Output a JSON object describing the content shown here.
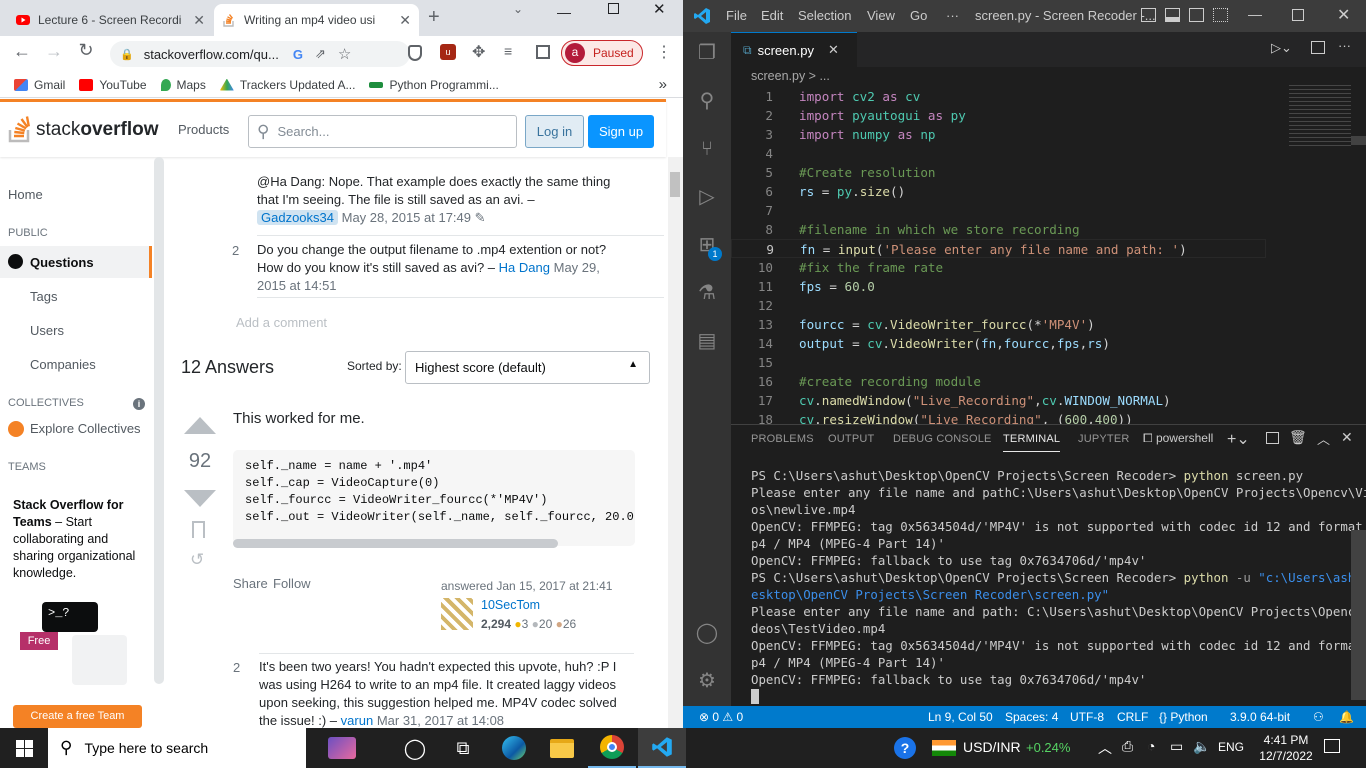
{
  "browser": {
    "tabs": [
      {
        "title": "Lecture 6 - Screen Recordi",
        "active": false
      },
      {
        "title": "Writing an mp4 video usi",
        "active": true
      }
    ],
    "url": "stackoverflow.com/qu...",
    "profile_label": "Paused",
    "profile_initial": "a",
    "bookmarks": [
      "Gmail",
      "YouTube",
      "Maps",
      "Trackers Updated A...",
      "Python Programmi..."
    ],
    "bookmarks_more": "»"
  },
  "so": {
    "logo_a": "stack",
    "logo_b": "overflow",
    "products": "Products",
    "search_placeholder": "Search...",
    "login": "Log in",
    "signup": "Sign up",
    "nav": {
      "home": "Home",
      "public": "PUBLIC",
      "questions": "Questions",
      "tags": "Tags",
      "users": "Users",
      "companies": "Companies",
      "collectives": "COLLECTIVES",
      "explore": "Explore Collectives",
      "teams": "TEAMS"
    },
    "teams_promo": {
      "title": "Stack Overflow for Teams",
      "rest": " – Start collaborating and sharing organizational knowledge.",
      "free": "Free",
      "cta": "Create a free Team"
    },
    "comments": [
      {
        "text": "@Ha Dang: Nope. That example does exactly the same thing that I'm seeing. The file is still saved as an avi. –",
        "user": "Gadzooks34",
        "date": "May 28, 2015 at 17:49",
        "score": ""
      },
      {
        "score": "2",
        "text": "Do you change the output filename to .mp4 extention or not? How do you know it's still saved as avi? –",
        "user": "Ha Dang",
        "date": "May 29, 2015",
        "date2": "at 14:51"
      }
    ],
    "add_comment": "Add a comment",
    "answers_count": "12 Answers",
    "sorted_by": "Sorted by:",
    "sort_value": "Highest score (default)",
    "answer": {
      "votes": "92",
      "intro": "This worked for me.",
      "code": [
        "self._name = name + '.mp4'",
        "self._cap = VideoCapture(0)",
        "self._fourcc = VideoWriter_fourcc(*'MP4V')",
        "self._out = VideoWriter(self._name, self._fourcc, 20.0,"
      ],
      "share": "Share",
      "follow": "Follow",
      "answered": "answered Jan 15, 2017 at 21:41",
      "user": "10SecTom",
      "rep": "2,294",
      "gold": "3",
      "silver": "20",
      "bronze": "26"
    },
    "comment3": {
      "score": "2",
      "text": "It's been two years! You hadn't expected this upvote, huh? :P I was using H264 to write to an mp4 file. It created laggy videos upon seeking, this suggestion helped me. MP4V codec solved the issue! :) –",
      "user": "varun",
      "date": "Mar 31, 2017 at 14:08"
    }
  },
  "vscode": {
    "menu": [
      "File",
      "Edit",
      "Selection",
      "View",
      "Go",
      "···"
    ],
    "title": "screen.py - Screen Recoder -...",
    "tab": "screen.py",
    "breadcrumb": "screen.py > ...",
    "badge": "1",
    "code": [
      {
        "n": "1",
        "t": [
          [
            "kw",
            "import "
          ],
          [
            "cl",
            "cv2 "
          ],
          [
            "kw",
            "as "
          ],
          [
            "cl",
            "cv"
          ]
        ]
      },
      {
        "n": "2",
        "t": [
          [
            "kw",
            "import "
          ],
          [
            "cl",
            "pyautogui "
          ],
          [
            "kw",
            "as "
          ],
          [
            "cl",
            "py"
          ]
        ]
      },
      {
        "n": "3",
        "t": [
          [
            "kw",
            "import "
          ],
          [
            "cl",
            "numpy "
          ],
          [
            "kw",
            "as "
          ],
          [
            "cl",
            "np"
          ]
        ]
      },
      {
        "n": "4",
        "t": []
      },
      {
        "n": "5",
        "t": [
          [
            "cm",
            "#Create resolution"
          ]
        ]
      },
      {
        "n": "6",
        "t": [
          [
            "id",
            "rs"
          ],
          [
            "pl",
            " = "
          ],
          [
            "cl",
            "py"
          ],
          [
            "pl",
            "."
          ],
          [
            "fn",
            "size"
          ],
          [
            "pl",
            "()"
          ]
        ]
      },
      {
        "n": "7",
        "t": []
      },
      {
        "n": "8",
        "t": [
          [
            "cm",
            "#filename in which we store recording"
          ]
        ]
      },
      {
        "n": "9",
        "t": [
          [
            "id",
            "fn"
          ],
          [
            "pl",
            " = "
          ],
          [
            "fn",
            "input"
          ],
          [
            "pl",
            "("
          ],
          [
            "st",
            "'Please enter any file name and path: '"
          ],
          [
            "pl",
            ")"
          ]
        ]
      },
      {
        "n": "10",
        "t": [
          [
            "cm",
            "#fix the frame rate"
          ]
        ]
      },
      {
        "n": "11",
        "t": [
          [
            "id",
            "fps"
          ],
          [
            "pl",
            " = "
          ],
          [
            "nu",
            "60.0"
          ]
        ]
      },
      {
        "n": "12",
        "t": []
      },
      {
        "n": "13",
        "t": [
          [
            "id",
            "fourcc"
          ],
          [
            "pl",
            " = "
          ],
          [
            "cl",
            "cv"
          ],
          [
            "pl",
            "."
          ],
          [
            "fn",
            "VideoWriter_fourcc"
          ],
          [
            "pl",
            "(*"
          ],
          [
            "st",
            "'MP4V'"
          ],
          [
            "pl",
            ")"
          ]
        ]
      },
      {
        "n": "14",
        "t": [
          [
            "id",
            "output"
          ],
          [
            "pl",
            " = "
          ],
          [
            "cl",
            "cv"
          ],
          [
            "pl",
            "."
          ],
          [
            "fn",
            "VideoWriter"
          ],
          [
            "pl",
            "("
          ],
          [
            "id",
            "fn"
          ],
          [
            "pl",
            ","
          ],
          [
            "id",
            "fourcc"
          ],
          [
            "pl",
            ","
          ],
          [
            "id",
            "fps"
          ],
          [
            "pl",
            ","
          ],
          [
            "id",
            "rs"
          ],
          [
            "pl",
            ")"
          ]
        ]
      },
      {
        "n": "15",
        "t": []
      },
      {
        "n": "16",
        "t": [
          [
            "cm",
            "#create recording module"
          ]
        ]
      },
      {
        "n": "17",
        "t": [
          [
            "cl",
            "cv"
          ],
          [
            "pl",
            "."
          ],
          [
            "fn",
            "namedWindow"
          ],
          [
            "pl",
            "("
          ],
          [
            "st",
            "\"Live_Recording\""
          ],
          [
            "pl",
            ","
          ],
          [
            "cl",
            "cv"
          ],
          [
            "pl",
            "."
          ],
          [
            "id",
            "WINDOW_NORMAL"
          ],
          [
            "pl",
            ")"
          ]
        ]
      },
      {
        "n": "18",
        "t": [
          [
            "cl",
            "cv"
          ],
          [
            "pl",
            "."
          ],
          [
            "fn",
            "resizeWindow"
          ],
          [
            "pl",
            "("
          ],
          [
            "st",
            "\"Live_Recording\""
          ],
          [
            "pl",
            ", ("
          ],
          [
            "nu",
            "600"
          ],
          [
            "pl",
            ","
          ],
          [
            "nu",
            "400"
          ],
          [
            "pl",
            "))"
          ]
        ]
      }
    ],
    "panel_tabs": [
      "PROBLEMS",
      "OUTPUT",
      "DEBUG CONSOLE",
      "TERMINAL",
      "JUPYTER"
    ],
    "shell": "powershell",
    "terminal": [
      "PS C:\\Users\\ashut\\Desktop\\OpenCV Projects\\Screen Recoder> python screen.py",
      "Please enter any file name and pathC:\\Users\\ashut\\Desktop\\OpenCV Projects\\Opencv\\Vide",
      "os\\newlive.mp4",
      "OpenCV: FFMPEG: tag 0x5634504d/'MP4V' is not supported with codec id 12 and format 'm",
      "p4 / MP4 (MPEG-4 Part 14)'",
      "OpenCV: FFMPEG: fallback to use tag 0x7634706d/'mp4v'",
      "PS C:\\Users\\ashut\\Desktop\\OpenCV Projects\\Screen Recoder> python -u \"c:\\Users\\ashut\\D",
      "esktop\\OpenCV Projects\\Screen Recoder\\screen.py\"",
      "Please enter any file name and path: C:\\Users\\ashut\\Desktop\\OpenCV Projects\\Opencv\\Vi",
      "deos\\TestVideo.mp4",
      "OpenCV: FFMPEG: tag 0x5634504d/'MP4V' is not supported with codec id 12 and format 'm",
      "p4 / MP4 (MPEG-4 Part 14)'",
      "OpenCV: FFMPEG: fallback to use tag 0x7634706d/'mp4v'"
    ],
    "status": {
      "errors": "0",
      "warnings": "0",
      "position": "Ln 9, Col 50",
      "spaces": "Spaces: 4",
      "encoding": "UTF-8",
      "eol": "CRLF",
      "language": "Python",
      "interpreter": "3.9.0 64-bit"
    }
  },
  "taskbar": {
    "search_placeholder": "Type here to search",
    "ticker": "USD/INR",
    "ticker_change": "+0.24%",
    "lang": "ENG",
    "time": "4:41 PM",
    "date": "12/7/2022"
  },
  "colors": {
    "so_orange": "#f48225",
    "so_blue": "#0a95ff",
    "vscode_blue": "#007acc"
  }
}
